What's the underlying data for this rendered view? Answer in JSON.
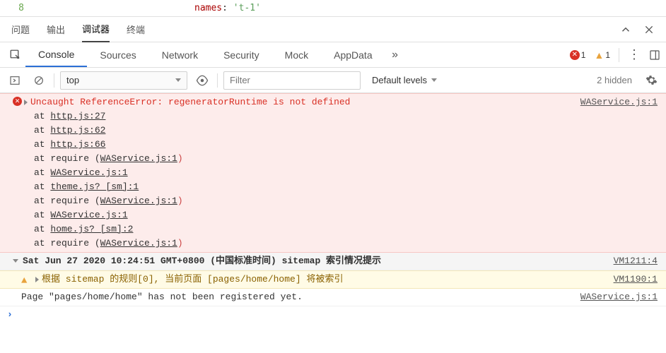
{
  "editor": {
    "line_no": "8",
    "code_key": "names",
    "code_colon": ":",
    "code_val": "'t-1'"
  },
  "panel_tabs": {
    "items": [
      "问题",
      "输出",
      "调试器",
      "终端"
    ],
    "active": 2
  },
  "devtools_tabs": {
    "items": [
      "Console",
      "Sources",
      "Network",
      "Security",
      "Mock",
      "AppData"
    ],
    "active": 0,
    "errors": "1",
    "warnings": "1"
  },
  "filter_bar": {
    "context": "top",
    "filter_placeholder": "Filter",
    "levels": "Default levels",
    "hidden": "2 hidden"
  },
  "messages": {
    "error": {
      "head": "Uncaught ReferenceError: regeneratorRuntime is not defined",
      "source": "WAService.js:1",
      "stack": [
        {
          "pre": "at ",
          "link": "http.js:27"
        },
        {
          "pre": "at ",
          "link": "http.js:62"
        },
        {
          "pre": "at ",
          "link": "http.js:66"
        },
        {
          "pre": "at require (",
          "link": "WAService.js:1",
          "post": ")"
        },
        {
          "pre": "at ",
          "link": "WAService.js:1"
        },
        {
          "pre": "at ",
          "link": "theme.js? [sm]:1"
        },
        {
          "pre": "at require (",
          "link": "WAService.js:1",
          "post": ")"
        },
        {
          "pre": "at ",
          "link": "WAService.js:1"
        },
        {
          "pre": "at ",
          "link": "home.js? [sm]:2"
        },
        {
          "pre": "at require (",
          "link": "WAService.js:1",
          "post": ")"
        }
      ]
    },
    "group": {
      "text": "Sat Jun 27 2020 10:24:51 GMT+0800 (中国标准时间) sitemap 索引情况提示",
      "source": "VM1211:4"
    },
    "warn": {
      "text": "根据 sitemap 的规则[0], 当前页面 [pages/home/home] 将被索引",
      "source": "VM1190:1"
    },
    "info": {
      "text": "Page \"pages/home/home\" has not been registered yet.",
      "source": "WAService.js:1"
    }
  },
  "prompt": "›"
}
